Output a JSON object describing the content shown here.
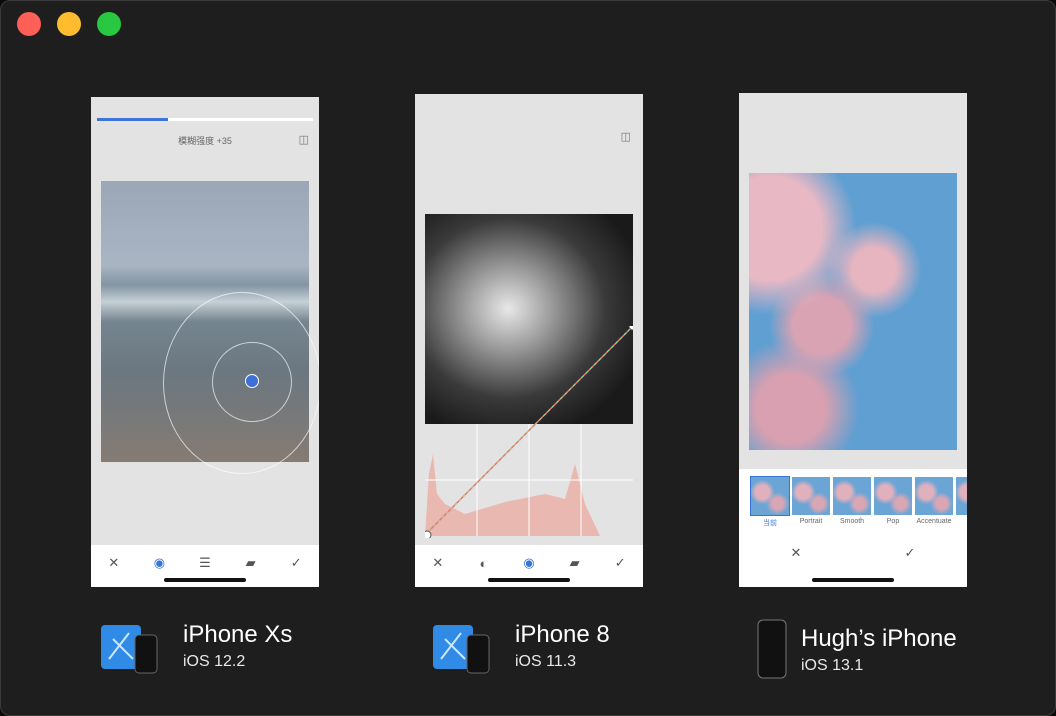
{
  "window": {
    "controls": [
      "close",
      "minimize",
      "maximize"
    ],
    "colors": {
      "close": "#fe5f57",
      "minimize": "#febc2e",
      "maximize": "#28c840"
    }
  },
  "screens": [
    {
      "device": "iPhone Xs",
      "os": "iOS 12.2",
      "icon": "xcode-simulator-icon",
      "status_label": "模糊强度 +35",
      "progress": 0.33,
      "toolbar": [
        "close-icon",
        "focus-icon",
        "adjust-sliders-icon",
        "eraser-icon",
        "checkmark-icon"
      ]
    },
    {
      "device": "iPhone 8",
      "os": "iOS 11.3",
      "icon": "xcode-simulator-icon",
      "toolbar": [
        "close-icon",
        "tone-icon",
        "eye-icon",
        "eraser-icon",
        "checkmark-icon"
      ]
    },
    {
      "device": "Hugh’s iPhone",
      "os": "iOS 13.1",
      "icon": "iphone-device-icon",
      "filters": [
        "当前",
        "Portrait",
        "Smooth",
        "Pop",
        "Accentuate",
        "Fa"
      ],
      "selected_filter": "当前",
      "actions": [
        "close-icon",
        "checkmark-icon"
      ]
    }
  ],
  "accent_color": "#3a74d9"
}
